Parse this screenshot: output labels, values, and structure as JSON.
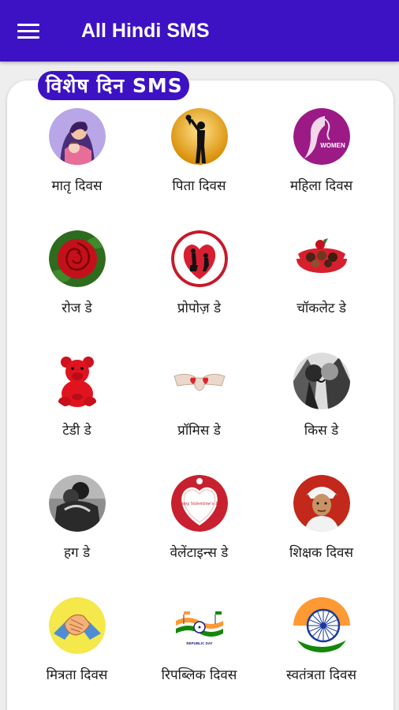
{
  "appbar": {
    "title": "All Hindi SMS"
  },
  "section": {
    "title": "विशेष दिन SMS"
  },
  "items": [
    {
      "label": "मातृ दिवस",
      "icon": "mother-icon"
    },
    {
      "label": "पिता दिवस",
      "icon": "father-icon"
    },
    {
      "label": "महिला दिवस",
      "icon": "women-icon"
    },
    {
      "label": "रोज डे",
      "icon": "rose-icon"
    },
    {
      "label": "प्रोपोज़ डे",
      "icon": "propose-icon"
    },
    {
      "label": "चॉकलेट डे",
      "icon": "chocolate-icon"
    },
    {
      "label": "टेडी डे",
      "icon": "teddy-icon"
    },
    {
      "label": "प्रॉमिस डे",
      "icon": "promise-icon"
    },
    {
      "label": "किस डे",
      "icon": "kiss-icon"
    },
    {
      "label": "हग डे",
      "icon": "hug-icon"
    },
    {
      "label": "वेलेंटाइन्स डे",
      "icon": "valentine-icon"
    },
    {
      "label": "शिक्षक दिवस",
      "icon": "teacher-icon"
    },
    {
      "label": "मित्रता दिवस",
      "icon": "friendship-icon"
    },
    {
      "label": "रिपब्लिक दिवस",
      "icon": "republic-icon"
    },
    {
      "label": "स्वतंत्रता दिवस",
      "icon": "independence-icon"
    }
  ],
  "badges": {
    "women": "WOMEN",
    "valentine": "Happy Valentine's Day",
    "republic": "REPUBLIC DAY"
  },
  "colors": {
    "primary": "#3d12c4",
    "card": "#ffffff",
    "background": "#eeeeee"
  }
}
